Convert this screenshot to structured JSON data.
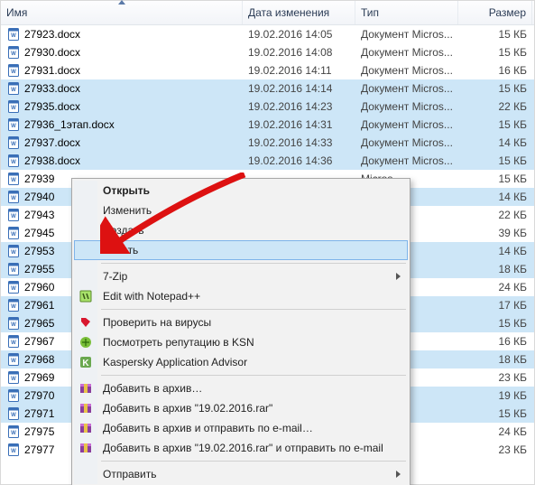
{
  "columns": {
    "name": "Имя",
    "date": "Дата изменения",
    "type": "Тип",
    "size": "Размер"
  },
  "type_label": "Документ Micros...",
  "type_label_short": "Micros...",
  "files": [
    {
      "name": "27923.docx",
      "date": "19.02.2016 14:05",
      "size": "15 КБ",
      "sel": false,
      "full": true
    },
    {
      "name": "27930.docx",
      "date": "19.02.2016 14:08",
      "size": "15 КБ",
      "sel": false,
      "full": true
    },
    {
      "name": "27931.docx",
      "date": "19.02.2016 14:11",
      "size": "16 КБ",
      "sel": false,
      "full": true
    },
    {
      "name": "27933.docx",
      "date": "19.02.2016 14:14",
      "size": "15 КБ",
      "sel": true,
      "full": true
    },
    {
      "name": "27935.docx",
      "date": "19.02.2016 14:23",
      "size": "22 КБ",
      "sel": true,
      "full": true
    },
    {
      "name": "27936_1этап.docx",
      "date": "19.02.2016 14:31",
      "size": "15 КБ",
      "sel": true,
      "full": true
    },
    {
      "name": "27937.docx",
      "date": "19.02.2016 14:33",
      "size": "14 КБ",
      "sel": true,
      "full": true
    },
    {
      "name": "27938.docx",
      "date": "19.02.2016 14:36",
      "size": "15 КБ",
      "sel": true,
      "full": true
    },
    {
      "name": "27939",
      "date": "",
      "size": "15 КБ",
      "sel": false,
      "full": false
    },
    {
      "name": "27940",
      "date": "",
      "size": "14 КБ",
      "sel": true,
      "full": false
    },
    {
      "name": "27943",
      "date": "",
      "size": "22 КБ",
      "sel": false,
      "full": false
    },
    {
      "name": "27945",
      "date": "",
      "size": "39 КБ",
      "sel": false,
      "full": false
    },
    {
      "name": "27953",
      "date": "",
      "size": "14 КБ",
      "sel": true,
      "full": false
    },
    {
      "name": "27955",
      "date": "",
      "size": "18 КБ",
      "sel": true,
      "full": false
    },
    {
      "name": "27960",
      "date": "",
      "size": "24 КБ",
      "sel": false,
      "full": false
    },
    {
      "name": "27961",
      "date": "",
      "size": "17 КБ",
      "sel": true,
      "full": false
    },
    {
      "name": "27965",
      "date": "",
      "size": "15 КБ",
      "sel": true,
      "full": false
    },
    {
      "name": "27967",
      "date": "",
      "size": "16 КБ",
      "sel": false,
      "full": false
    },
    {
      "name": "27968",
      "date": "",
      "size": "18 КБ",
      "sel": true,
      "full": false
    },
    {
      "name": "27969",
      "date": "",
      "size": "23 КБ",
      "sel": false,
      "full": false
    },
    {
      "name": "27970",
      "date": "",
      "size": "19 КБ",
      "sel": true,
      "full": false
    },
    {
      "name": "27971",
      "date": "",
      "size": "15 КБ",
      "sel": true,
      "full": false
    },
    {
      "name": "27975",
      "date": "",
      "size": "24 КБ",
      "sel": false,
      "full": false
    },
    {
      "name": "27977",
      "date": "",
      "size": "23 КБ",
      "sel": false,
      "full": false
    }
  ],
  "menu": {
    "open": "Открыть",
    "edit": "Изменить",
    "new": "Создать",
    "print": "Печать",
    "szip": "7-Zip",
    "npp": "Edit with Notepad++",
    "av": "Проверить на вирусы",
    "ksn": "Посмотреть репутацию в KSN",
    "kaa": "Kaspersky Application Advisor",
    "rar1": "Добавить в архив…",
    "rar2": "Добавить в архив \"19.02.2016.rar\"",
    "rar3": "Добавить в архив и отправить по e-mail…",
    "rar4": "Добавить в архив \"19.02.2016.rar\" и отправить по e-mail",
    "send": "Отправить"
  }
}
